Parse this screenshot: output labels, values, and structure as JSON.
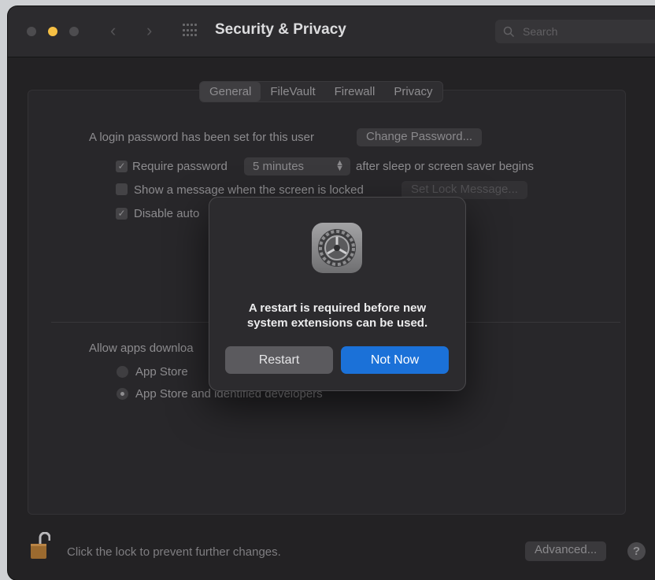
{
  "window": {
    "title": "Security & Privacy",
    "traffic_lights": [
      "close",
      "minimize",
      "zoom"
    ],
    "traffic_light_colors": {
      "close": "#4d4c4f",
      "minimize": "#f6c044",
      "zoom": "#4d4c4f"
    },
    "search_placeholder": "Search"
  },
  "tabs": [
    {
      "label": "General",
      "selected": true
    },
    {
      "label": "FileVault",
      "selected": false
    },
    {
      "label": "Firewall",
      "selected": false
    },
    {
      "label": "Privacy",
      "selected": false
    }
  ],
  "general": {
    "login_text": "A login password has been set for this user",
    "change_password_label": "Change Password...",
    "require_password": {
      "checked": true,
      "label": "Require password",
      "select_value": "5 minutes",
      "suffix": "after sleep or screen saver begins"
    },
    "show_message": {
      "checked": false,
      "label": "Show a message when the screen is locked",
      "button_label": "Set Lock Message..."
    },
    "disable_auto": {
      "checked": true,
      "label": "Disable auto"
    },
    "allow_apps_label": "Allow apps downloa",
    "radio_options": [
      {
        "label": "App Store",
        "selected": false
      },
      {
        "label": "App Store and identified developers",
        "selected": true
      }
    ]
  },
  "footer": {
    "lock_text": "Click the lock to prevent further changes.",
    "advanced_label": "Advanced...",
    "help_label": "?"
  },
  "dialog": {
    "icon": "system-preferences-gear-icon",
    "message_line1": "A restart is required before new",
    "message_line2": "system extensions can be used.",
    "restart_label": "Restart",
    "not_now_label": "Not Now",
    "accent_color": "#1b71d8"
  }
}
